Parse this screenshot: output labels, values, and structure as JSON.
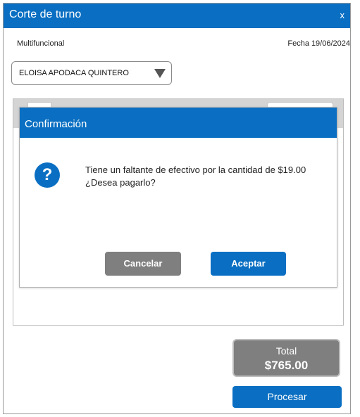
{
  "window": {
    "title": "Corte de turno",
    "close_label": "x"
  },
  "header": {
    "branch": "Multifuncional",
    "date_label": "Fecha",
    "date_value": "19/06/2024"
  },
  "user_select": {
    "value": "ELOISA APODACA QUINTERO",
    "icon": "triangle-down-icon"
  },
  "dialog": {
    "title": "Confirmación",
    "icon": "question-circle-icon",
    "message": "Tiene un faltante de efectivo por la cantidad de $19.00 ¿Desea pagarlo?",
    "cancel_label": "Cancelar",
    "accept_label": "Aceptar"
  },
  "total": {
    "label": "Total",
    "value": "$765.00"
  },
  "actions": {
    "process_label": "Procesar"
  },
  "colors": {
    "primary": "#0a6fc2",
    "secondary": "#7f7f7f",
    "strip": "#d4d4d4"
  }
}
